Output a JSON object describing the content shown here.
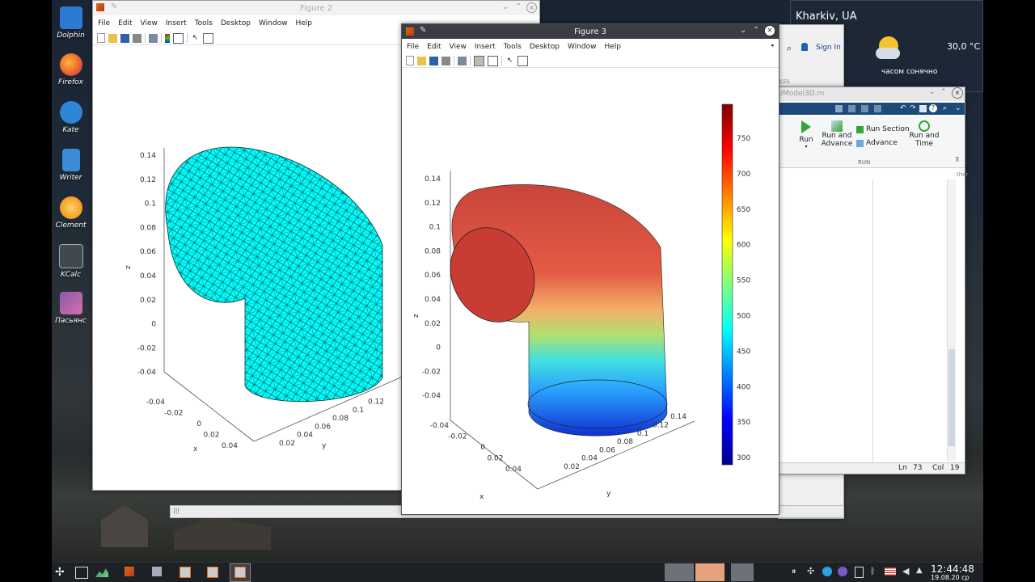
{
  "desktop_icons": [
    {
      "label": "Dolphin",
      "color": "#2b7bd4"
    },
    {
      "label": "Firefox",
      "color": "#e8602b"
    },
    {
      "label": "Kate",
      "color": "#2f86d6"
    },
    {
      "label": "Writer",
      "color": "#3d8ad8"
    },
    {
      "label": "Clement",
      "color": "#f39b24"
    },
    {
      "label": "KCalc",
      "color": "#404850"
    },
    {
      "label": "Пасьянс",
      "color": "#8a5aa8"
    }
  ],
  "weather": {
    "city": "Kharkiv, UA",
    "temp": "30,0 °C",
    "desc": "часом сонячно"
  },
  "fig2": {
    "title": "Figure 2",
    "menu": [
      "File",
      "Edit",
      "View",
      "Insert",
      "Tools",
      "Desktop",
      "Window",
      "Help"
    ],
    "zlabel": "z",
    "xlabel": "x",
    "ylabel": "y",
    "zticks": [
      "0.14",
      "0.12",
      "0.1",
      "0.08",
      "0.06",
      "0.04",
      "0.02",
      "0",
      "-0.02",
      "-0.04"
    ],
    "xticks": [
      "-0.04",
      "-0.02",
      "0",
      "0.02",
      "0.04"
    ],
    "yticks": [
      "0.02",
      "0.04",
      "0.06",
      "0.08",
      "0.1",
      "0.12"
    ],
    "surface_color": "#00ffff",
    "status_text": "|||"
  },
  "fig3": {
    "title": "Figure 3",
    "menu": [
      "File",
      "Edit",
      "View",
      "Insert",
      "Tools",
      "Desktop",
      "Window",
      "Help"
    ],
    "zlabel": "z",
    "xlabel": "x",
    "ylabel": "y",
    "zticks": [
      "0.14",
      "0.12",
      "0.1",
      "0.08",
      "0.06",
      "0.04",
      "0.02",
      "0",
      "-0.02",
      "-0.04"
    ],
    "xticks": [
      "-0.04",
      "-0.02",
      "0",
      "0.02",
      "0.04"
    ],
    "yticks": [
      "0.02",
      "0.04",
      "0.06",
      "0.08",
      "0.1",
      "0.12",
      "0.14"
    ],
    "colorbar_ticks": [
      "750",
      "700",
      "650",
      "600",
      "550",
      "500",
      "450",
      "400",
      "350",
      "300"
    ]
  },
  "editor": {
    "title_path": "/Model3D.m",
    "signin": "Sign In",
    "section_faded": "ICES",
    "run": "Run",
    "run_advance": [
      "Run and",
      "Advance"
    ],
    "run_section": "Run Section",
    "advance": "Advance",
    "run_time": [
      "Run and",
      "Time"
    ],
    "group": "RUN",
    "side_text": "ther",
    "ln_label": "Ln",
    "ln": "73",
    "col_label": "Col",
    "col": "19"
  },
  "taskbar": {
    "time": "12:44:48",
    "date": "19.08.20 ср"
  }
}
